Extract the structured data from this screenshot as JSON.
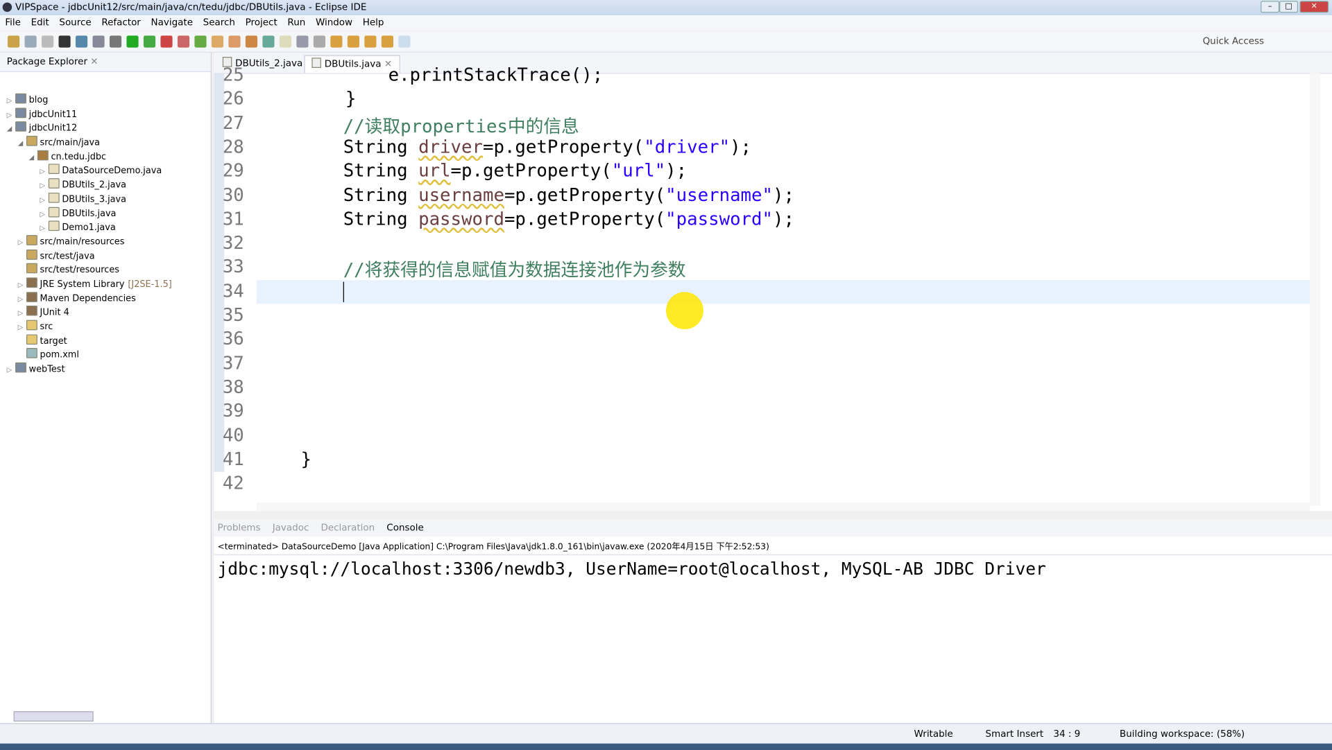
{
  "window": {
    "title": "VIPSpace - jdbcUnit12/src/main/java/cn/tedu/jdbc/DBUtils.java - Eclipse IDE"
  },
  "menu": [
    "File",
    "Edit",
    "Source",
    "Refactor",
    "Navigate",
    "Search",
    "Project",
    "Run",
    "Window",
    "Help"
  ],
  "toolbar": {
    "quick_access": "Quick Access"
  },
  "package_explorer": {
    "title": "Package Explorer",
    "items": [
      {
        "label": "blog",
        "depth": 0,
        "icon": "project-icon",
        "twisty": "▷"
      },
      {
        "label": "jdbcUnit11",
        "depth": 0,
        "icon": "project-icon",
        "twisty": "▷"
      },
      {
        "label": "jdbcUnit12",
        "depth": 0,
        "icon": "project-icon",
        "twisty": "◢"
      },
      {
        "label": "src/main/java",
        "depth": 1,
        "icon": "source-folder-icon",
        "twisty": "◢"
      },
      {
        "label": "cn.tedu.jdbc",
        "depth": 2,
        "icon": "package-icon",
        "twisty": "◢"
      },
      {
        "label": "DataSourceDemo.java",
        "depth": 3,
        "icon": "java-file-icon",
        "twisty": "▷"
      },
      {
        "label": "DBUtils_2.java",
        "depth": 3,
        "icon": "java-file-icon",
        "twisty": "▷"
      },
      {
        "label": "DBUtils_3.java",
        "depth": 3,
        "icon": "java-file-icon",
        "twisty": "▷"
      },
      {
        "label": "DBUtils.java",
        "depth": 3,
        "icon": "java-file-icon",
        "twisty": "▷"
      },
      {
        "label": "Demo1.java",
        "depth": 3,
        "icon": "java-file-icon",
        "twisty": "▷"
      },
      {
        "label": "src/main/resources",
        "depth": 1,
        "icon": "source-folder-icon",
        "twisty": "▷"
      },
      {
        "label": "src/test/java",
        "depth": 1,
        "icon": "source-folder-icon",
        "twisty": ""
      },
      {
        "label": "src/test/resources",
        "depth": 1,
        "icon": "source-folder-icon",
        "twisty": ""
      },
      {
        "label": "JRE System Library",
        "suffix": "[J2SE-1.5]",
        "depth": 1,
        "icon": "library-icon",
        "twisty": "▷"
      },
      {
        "label": "Maven Dependencies",
        "depth": 1,
        "icon": "library-icon",
        "twisty": "▷"
      },
      {
        "label": "JUnit 4",
        "depth": 1,
        "icon": "library-icon",
        "twisty": "▷"
      },
      {
        "label": "src",
        "depth": 1,
        "icon": "folder-icon",
        "twisty": "▷"
      },
      {
        "label": "target",
        "depth": 1,
        "icon": "folder-icon",
        "twisty": ""
      },
      {
        "label": "pom.xml",
        "depth": 1,
        "icon": "xml-file-icon",
        "twisty": ""
      },
      {
        "label": "webTest",
        "depth": 0,
        "icon": "project-icon",
        "twisty": "▷"
      }
    ]
  },
  "editor": {
    "tabs": [
      {
        "label": "DBUtils_2.java",
        "active": false
      },
      {
        "label": "DBUtils.java",
        "active": true
      }
    ],
    "lines": [
      {
        "n": "25",
        "html": "        e.printStackTrace();",
        "indent": 1
      },
      {
        "n": "26",
        "parts": [
          [
            "kw",
            "    }"
          ]
        ]
      },
      {
        "n": "27",
        "parts": [
          [
            "cm",
            "//读取properties中的信息"
          ]
        ]
      },
      {
        "n": "28",
        "parts": [
          [
            "kw",
            "String "
          ],
          [
            "var",
            "driver"
          ],
          [
            "kw",
            "=p.getProperty("
          ],
          [
            "str",
            "\"driver\""
          ],
          [
            "kw",
            ");"
          ]
        ]
      },
      {
        "n": "29",
        "parts": [
          [
            "kw",
            "String "
          ],
          [
            "var",
            "url"
          ],
          [
            "kw",
            "=p.getProperty("
          ],
          [
            "str",
            "\"url\""
          ],
          [
            "kw",
            ");"
          ]
        ]
      },
      {
        "n": "30",
        "parts": [
          [
            "kw",
            "String "
          ],
          [
            "var",
            "username"
          ],
          [
            "kw",
            "=p.getProperty("
          ],
          [
            "str",
            "\"username\""
          ],
          [
            "kw",
            ");"
          ]
        ]
      },
      {
        "n": "31",
        "parts": [
          [
            "kw",
            "String "
          ],
          [
            "var",
            "password"
          ],
          [
            "kw",
            "=p.getProperty("
          ],
          [
            "str",
            "\"password\""
          ],
          [
            "kw",
            ");"
          ]
        ]
      },
      {
        "n": "32",
        "parts": []
      },
      {
        "n": "33",
        "parts": [
          [
            "cm",
            "//将获得的信息赋值为数据连接池作为参数"
          ]
        ]
      },
      {
        "n": "34",
        "parts": []
      },
      {
        "n": "35",
        "parts": []
      },
      {
        "n": "36",
        "parts": []
      },
      {
        "n": "37",
        "parts": []
      },
      {
        "n": "38",
        "parts": []
      },
      {
        "n": "39",
        "parts": []
      },
      {
        "n": "40",
        "parts": []
      },
      {
        "n": "41",
        "parts": [
          [
            "kw",
            "}"
          ]
        ]
      },
      {
        "n": "42",
        "parts": []
      }
    ],
    "line25": "e.printStackTrace();"
  },
  "console": {
    "tabs": [
      "Problems",
      "Javadoc",
      "Declaration",
      "Console"
    ],
    "header": "<terminated> DataSourceDemo [Java Application] C:\\Program Files\\Java\\jdk1.8.0_161\\bin\\javaw.exe (2020年4月15日 下午2:52:53)",
    "output": "jdbc:mysql://localhost:3306/newdb3, UserName=root@localhost, MySQL-AB JDBC Driver"
  },
  "status": {
    "mode": "Writable",
    "insert": "Smart Insert",
    "position": "34 : 9",
    "progress": "Building workspace: (58%)"
  }
}
